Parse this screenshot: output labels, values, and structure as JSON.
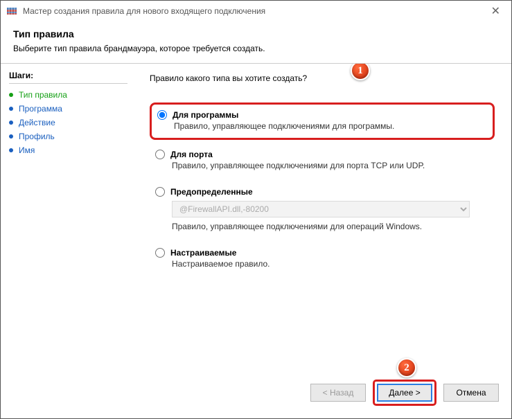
{
  "window": {
    "title": "Мастер создания правила для нового входящего подключения"
  },
  "header": {
    "title": "Тип правила",
    "subtitle": "Выберите тип правила брандмауэра, которое требуется создать."
  },
  "sidebar": {
    "title": "Шаги:",
    "steps": [
      {
        "label": "Тип правила",
        "state": "current"
      },
      {
        "label": "Программа",
        "state": "upcoming"
      },
      {
        "label": "Действие",
        "state": "upcoming"
      },
      {
        "label": "Профиль",
        "state": "upcoming"
      },
      {
        "label": "Имя",
        "state": "upcoming"
      }
    ]
  },
  "main": {
    "question": "Правило какого типа вы хотите создать?",
    "options": {
      "program": {
        "label": "Для программы",
        "desc": "Правило, управляющее подключениями для программы."
      },
      "port": {
        "label": "Для порта",
        "desc": "Правило, управляющее подключениями для порта TCP или UDP."
      },
      "predefined": {
        "label": "Предопределенные",
        "select_value": "@FirewallAPI.dll,-80200",
        "desc": "Правило, управляющее подключениями для операций Windows."
      },
      "custom": {
        "label": "Настраиваемые",
        "desc": "Настраиваемое правило."
      }
    }
  },
  "footer": {
    "back": "< Назад",
    "next": "Далее >",
    "cancel": "Отмена"
  },
  "markers": {
    "m1": "1",
    "m2": "2"
  }
}
